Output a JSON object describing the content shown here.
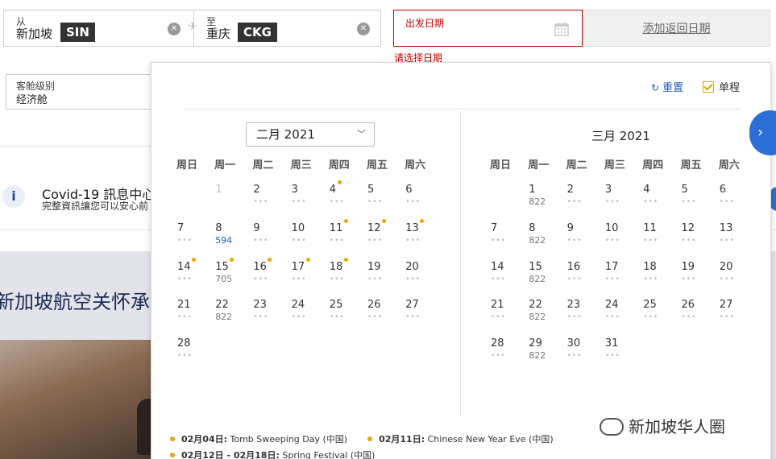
{
  "search": {
    "from": {
      "label": "从",
      "city": "新加坡",
      "code": "SIN"
    },
    "to": {
      "label": "至",
      "city": "重庆",
      "code": "CKG"
    },
    "depart": {
      "label": "出发日期",
      "error": "请选择日期"
    },
    "return_label": "添加返回日期"
  },
  "background": {
    "cabin_label": "客舱级别",
    "cabin_value": "经济舱",
    "covid_title": "Covid-19 訊息中心",
    "covid_sub": "完整資訊讓您可以安心前",
    "hero_title": "新加坡航空关怀承诺"
  },
  "picker": {
    "reset_label": "重置",
    "oneway_label": "单程",
    "left_month": "二月 2021",
    "right_month": "三月 2021",
    "weekdays": [
      "周日",
      "周一",
      "周二",
      "周三",
      "周四",
      "周五",
      "周六"
    ],
    "feb": [
      {
        "d": "1",
        "muted": true
      },
      {
        "d": "2"
      },
      {
        "d": "3"
      },
      {
        "d": "4",
        "holiday": true
      },
      {
        "d": "5"
      },
      {
        "d": "6"
      },
      {
        "d": "7"
      },
      {
        "d": "8",
        "price": "594",
        "blue": true
      },
      {
        "d": "9"
      },
      {
        "d": "10"
      },
      {
        "d": "11",
        "holiday": true
      },
      {
        "d": "12",
        "holiday": true
      },
      {
        "d": "13",
        "holiday": true
      },
      {
        "d": "14",
        "holiday": true
      },
      {
        "d": "15",
        "holiday": true,
        "price": "705"
      },
      {
        "d": "16",
        "holiday": true
      },
      {
        "d": "17",
        "holiday": true
      },
      {
        "d": "18",
        "holiday": true
      },
      {
        "d": "19"
      },
      {
        "d": "20"
      },
      {
        "d": "21"
      },
      {
        "d": "22",
        "price": "822"
      },
      {
        "d": "23"
      },
      {
        "d": "24"
      },
      {
        "d": "25"
      },
      {
        "d": "26"
      },
      {
        "d": "27"
      },
      {
        "d": "28"
      }
    ],
    "mar": [
      {
        "d": "1",
        "price": "822"
      },
      {
        "d": "2"
      },
      {
        "d": "3"
      },
      {
        "d": "4"
      },
      {
        "d": "5"
      },
      {
        "d": "6"
      },
      {
        "d": "7"
      },
      {
        "d": "8",
        "price": "822"
      },
      {
        "d": "9"
      },
      {
        "d": "10"
      },
      {
        "d": "11"
      },
      {
        "d": "12"
      },
      {
        "d": "13"
      },
      {
        "d": "14"
      },
      {
        "d": "15",
        "price": "822"
      },
      {
        "d": "16"
      },
      {
        "d": "17"
      },
      {
        "d": "18"
      },
      {
        "d": "19"
      },
      {
        "d": "20"
      },
      {
        "d": "21"
      },
      {
        "d": "22",
        "price": "822"
      },
      {
        "d": "23"
      },
      {
        "d": "24"
      },
      {
        "d": "25"
      },
      {
        "d": "26"
      },
      {
        "d": "27"
      },
      {
        "d": "28"
      },
      {
        "d": "29",
        "price": "822"
      },
      {
        "d": "30"
      },
      {
        "d": "31"
      }
    ],
    "legend": [
      {
        "date": "02月04日:",
        "text": " Tomb Sweeping Day (中国)"
      },
      {
        "date": "02月11日:",
        "text": " Chinese New Year Eve (中国)"
      },
      {
        "date": "02月12日 - 02月18日:",
        "text": " Spring Festival (中国)"
      }
    ],
    "dot_glyph": "•••",
    "holiday_color": "#f0a500",
    "accent_color": "#1d5fb8",
    "error_color": "#cc0000"
  },
  "watermark": "新加坡华人圈"
}
